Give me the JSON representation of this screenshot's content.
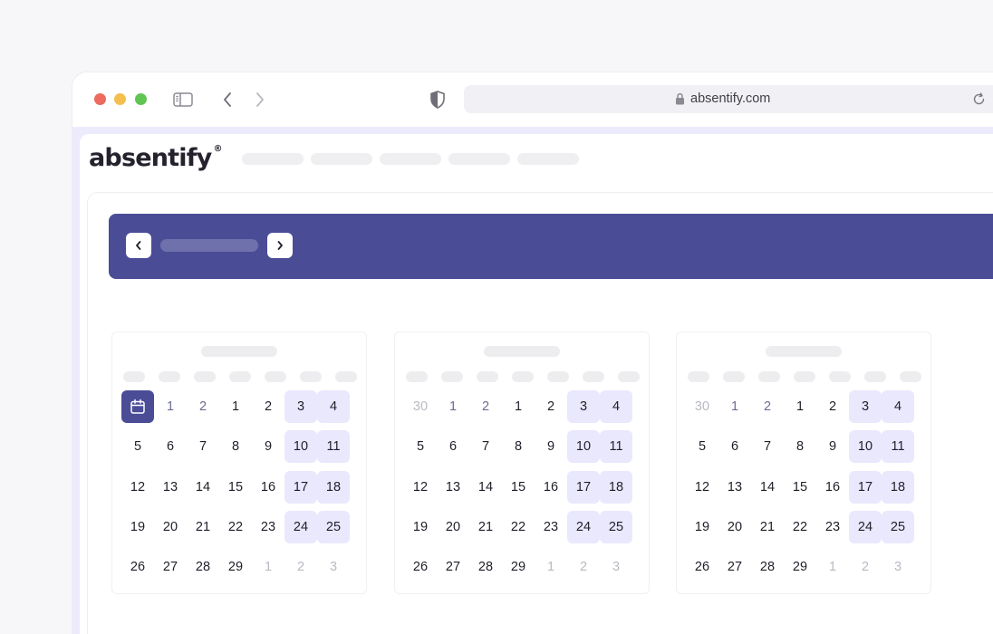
{
  "browser": {
    "url": "absentify.com"
  },
  "app": {
    "logo_text": "absentify",
    "logo_mark": "®"
  },
  "colors": {
    "brand": "#4a4c96",
    "weekend_highlight": "#e9e8fd",
    "window_red": "#ec6a5e",
    "window_yellow": "#f4bf4f",
    "window_green": "#61c554"
  },
  "months": [
    {
      "rows": [
        [
          {
            "t": "",
            "k": "today"
          },
          {
            "t": "1",
            "k": "accent"
          },
          {
            "t": "2",
            "k": "accent"
          },
          {
            "t": "1",
            "k": ""
          },
          {
            "t": "2",
            "k": ""
          },
          {
            "t": "3",
            "k": "weekend"
          },
          {
            "t": "4",
            "k": "weekend"
          }
        ],
        [
          {
            "t": "5",
            "k": ""
          },
          {
            "t": "6",
            "k": ""
          },
          {
            "t": "7",
            "k": ""
          },
          {
            "t": "8",
            "k": ""
          },
          {
            "t": "9",
            "k": ""
          },
          {
            "t": "10",
            "k": "weekend"
          },
          {
            "t": "11",
            "k": "weekend"
          }
        ],
        [
          {
            "t": "12",
            "k": ""
          },
          {
            "t": "13",
            "k": ""
          },
          {
            "t": "14",
            "k": ""
          },
          {
            "t": "15",
            "k": ""
          },
          {
            "t": "16",
            "k": ""
          },
          {
            "t": "17",
            "k": "weekend"
          },
          {
            "t": "18",
            "k": "weekend"
          }
        ],
        [
          {
            "t": "19",
            "k": ""
          },
          {
            "t": "20",
            "k": ""
          },
          {
            "t": "21",
            "k": ""
          },
          {
            "t": "22",
            "k": ""
          },
          {
            "t": "23",
            "k": ""
          },
          {
            "t": "24",
            "k": "weekend"
          },
          {
            "t": "25",
            "k": "weekend"
          }
        ],
        [
          {
            "t": "26",
            "k": ""
          },
          {
            "t": "27",
            "k": ""
          },
          {
            "t": "28",
            "k": ""
          },
          {
            "t": "29",
            "k": ""
          },
          {
            "t": "1",
            "k": "muted"
          },
          {
            "t": "2",
            "k": "muted"
          },
          {
            "t": "3",
            "k": "muted"
          }
        ]
      ]
    },
    {
      "rows": [
        [
          {
            "t": "30",
            "k": "muted"
          },
          {
            "t": "1",
            "k": "accent"
          },
          {
            "t": "2",
            "k": "accent"
          },
          {
            "t": "1",
            "k": ""
          },
          {
            "t": "2",
            "k": ""
          },
          {
            "t": "3",
            "k": "weekend"
          },
          {
            "t": "4",
            "k": "weekend"
          }
        ],
        [
          {
            "t": "5",
            "k": ""
          },
          {
            "t": "6",
            "k": ""
          },
          {
            "t": "7",
            "k": ""
          },
          {
            "t": "8",
            "k": ""
          },
          {
            "t": "9",
            "k": ""
          },
          {
            "t": "10",
            "k": "weekend"
          },
          {
            "t": "11",
            "k": "weekend"
          }
        ],
        [
          {
            "t": "12",
            "k": ""
          },
          {
            "t": "13",
            "k": ""
          },
          {
            "t": "14",
            "k": ""
          },
          {
            "t": "15",
            "k": ""
          },
          {
            "t": "16",
            "k": ""
          },
          {
            "t": "17",
            "k": "weekend"
          },
          {
            "t": "18",
            "k": "weekend"
          }
        ],
        [
          {
            "t": "19",
            "k": ""
          },
          {
            "t": "20",
            "k": ""
          },
          {
            "t": "21",
            "k": ""
          },
          {
            "t": "22",
            "k": ""
          },
          {
            "t": "23",
            "k": ""
          },
          {
            "t": "24",
            "k": "weekend"
          },
          {
            "t": "25",
            "k": "weekend"
          }
        ],
        [
          {
            "t": "26",
            "k": ""
          },
          {
            "t": "27",
            "k": ""
          },
          {
            "t": "28",
            "k": ""
          },
          {
            "t": "29",
            "k": ""
          },
          {
            "t": "1",
            "k": "muted"
          },
          {
            "t": "2",
            "k": "muted"
          },
          {
            "t": "3",
            "k": "muted"
          }
        ]
      ]
    },
    {
      "rows": [
        [
          {
            "t": "30",
            "k": "muted"
          },
          {
            "t": "1",
            "k": "accent"
          },
          {
            "t": "2",
            "k": "accent"
          },
          {
            "t": "1",
            "k": ""
          },
          {
            "t": "2",
            "k": ""
          },
          {
            "t": "3",
            "k": "weekend"
          },
          {
            "t": "4",
            "k": "weekend"
          }
        ],
        [
          {
            "t": "5",
            "k": ""
          },
          {
            "t": "6",
            "k": ""
          },
          {
            "t": "7",
            "k": ""
          },
          {
            "t": "8",
            "k": ""
          },
          {
            "t": "9",
            "k": ""
          },
          {
            "t": "10",
            "k": "weekend"
          },
          {
            "t": "11",
            "k": "weekend"
          }
        ],
        [
          {
            "t": "12",
            "k": ""
          },
          {
            "t": "13",
            "k": ""
          },
          {
            "t": "14",
            "k": ""
          },
          {
            "t": "15",
            "k": ""
          },
          {
            "t": "16",
            "k": ""
          },
          {
            "t": "17",
            "k": "weekend"
          },
          {
            "t": "18",
            "k": "weekend"
          }
        ],
        [
          {
            "t": "19",
            "k": ""
          },
          {
            "t": "20",
            "k": ""
          },
          {
            "t": "21",
            "k": ""
          },
          {
            "t": "22",
            "k": ""
          },
          {
            "t": "23",
            "k": ""
          },
          {
            "t": "24",
            "k": "weekend"
          },
          {
            "t": "25",
            "k": "weekend"
          }
        ],
        [
          {
            "t": "26",
            "k": ""
          },
          {
            "t": "27",
            "k": ""
          },
          {
            "t": "28",
            "k": ""
          },
          {
            "t": "29",
            "k": ""
          },
          {
            "t": "1",
            "k": "muted"
          },
          {
            "t": "2",
            "k": "muted"
          },
          {
            "t": "3",
            "k": "muted"
          }
        ]
      ]
    }
  ]
}
